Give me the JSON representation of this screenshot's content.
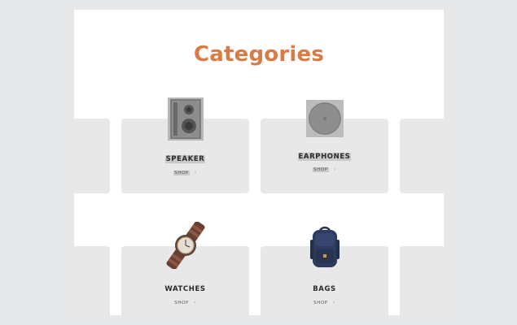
{
  "section": {
    "title": "Categories"
  },
  "categories": [
    {
      "name": "SPEAKER",
      "action": "SHOP",
      "arrow_icon": "chevron-right-icon"
    },
    {
      "name": "EARPHONES",
      "action": "SHOP",
      "arrow_icon": "chevron-right-icon"
    },
    {
      "name": "WATCHES",
      "action": "SHOP",
      "arrow_icon": "chevron-right-icon"
    },
    {
      "name": "BAGS",
      "action": "SHOP",
      "arrow_icon": "chevron-right-icon"
    }
  ],
  "colors": {
    "page_background": "#e7e8ea",
    "panel_background": "#ffffff",
    "card_background": "#e8e8e8",
    "accent": "#d97b45"
  }
}
